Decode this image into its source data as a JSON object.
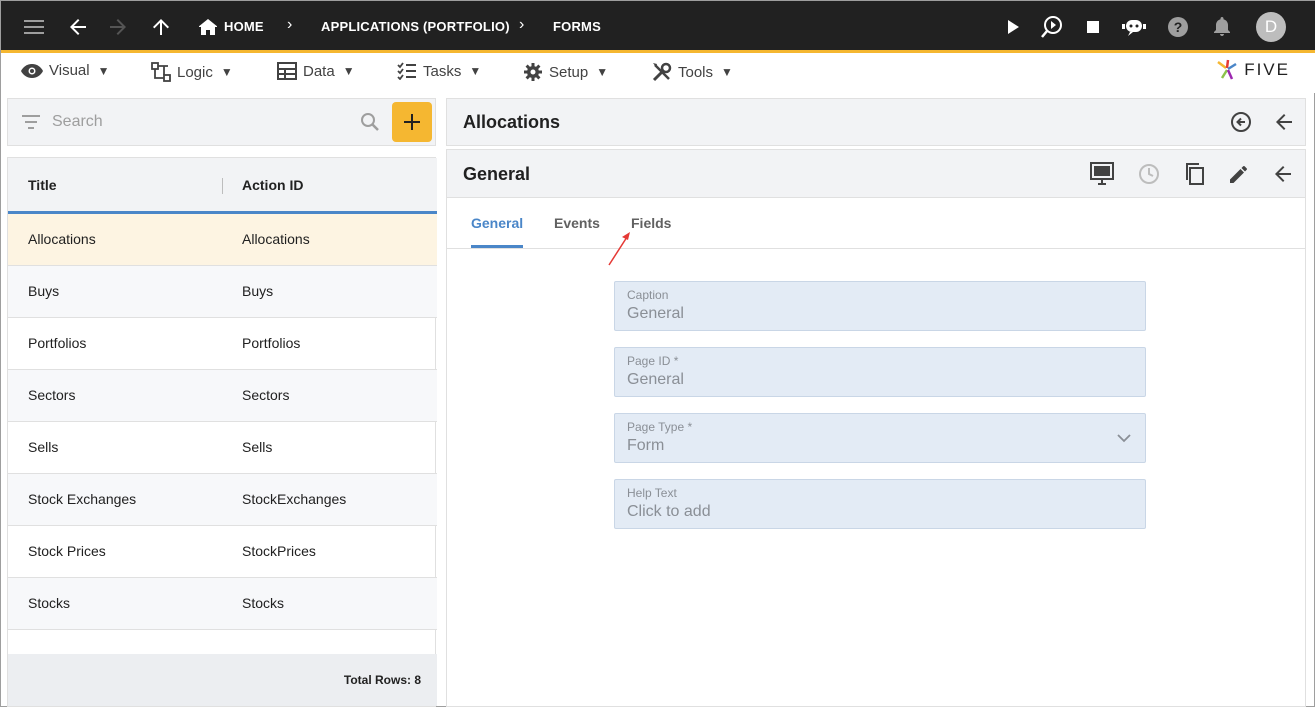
{
  "topbar": {
    "breadcrumbs": [
      "HOME",
      "APPLICATIONS (PORTFOLIO)",
      "FORMS"
    ],
    "avatar_initial": "D",
    "icons": [
      "menu-icon",
      "back-arrow-icon",
      "forward-arrow-icon",
      "up-arrow-icon",
      "home-icon",
      "play-icon",
      "run-search-icon",
      "stop-icon",
      "chat-bot-icon",
      "help-icon",
      "bell-icon"
    ]
  },
  "menubar": {
    "items": [
      {
        "label": "Visual",
        "icon": "eye-icon"
      },
      {
        "label": "Logic",
        "icon": "logic-icon"
      },
      {
        "label": "Data",
        "icon": "table-icon"
      },
      {
        "label": "Tasks",
        "icon": "checklist-icon"
      },
      {
        "label": "Setup",
        "icon": "gear-icon"
      },
      {
        "label": "Tools",
        "icon": "tools-icon"
      }
    ],
    "logo_text": "FIVE"
  },
  "search": {
    "placeholder": "Search"
  },
  "table": {
    "columns": [
      "Title",
      "Action ID"
    ],
    "rows": [
      {
        "title": "Allocations",
        "action_id": "Allocations"
      },
      {
        "title": "Buys",
        "action_id": "Buys"
      },
      {
        "title": "Portfolios",
        "action_id": "Portfolios"
      },
      {
        "title": "Sectors",
        "action_id": "Sectors"
      },
      {
        "title": "Sells",
        "action_id": "Sells"
      },
      {
        "title": "Stock Exchanges",
        "action_id": "StockExchanges"
      },
      {
        "title": "Stock Prices",
        "action_id": "StockPrices"
      },
      {
        "title": "Stocks",
        "action_id": "Stocks"
      }
    ],
    "selected_index": 0,
    "total_label": "Total Rows: 8"
  },
  "record": {
    "title": "Allocations"
  },
  "form": {
    "title": "General",
    "tabs": [
      "General",
      "Events",
      "Fields"
    ],
    "active_tab": "General",
    "fields": [
      {
        "label": "Caption",
        "value": "General"
      },
      {
        "label": "Page ID *",
        "value": "General"
      },
      {
        "label": "Page Type *",
        "value": "Form"
      },
      {
        "label": "Help Text",
        "value": "Click to add"
      }
    ]
  },
  "colors": {
    "topbar": "#212121",
    "accent": "#f5b731",
    "tab_active": "#4a86c8",
    "selected_row": "#fdf4e2",
    "field_bg": "#e3ebf5",
    "annotation_arrow": "#e53935"
  }
}
